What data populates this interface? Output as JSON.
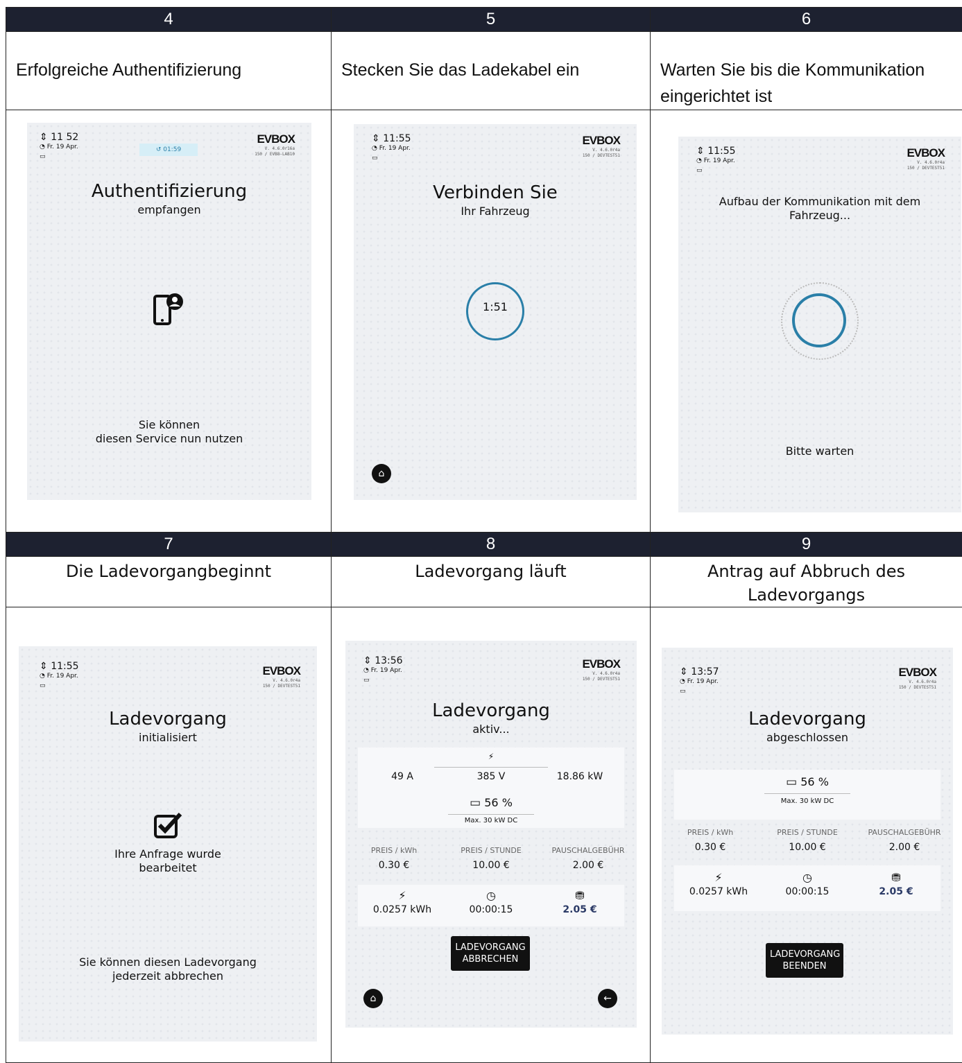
{
  "steps": [
    {
      "num": "4",
      "desc": "Erfolgreiche Authentifizierung",
      "time": "11 52",
      "date": "Fr. 19 Apr.",
      "timer": "01:59",
      "logo": "EVBOX",
      "ver1": "V. 4.6.0r16a",
      "ver2": "150 / EVB8-LAB10",
      "title": "Authentifizierung",
      "sub": "empfangen",
      "msg1": "Sie können",
      "msg2": "diesen Service nun nutzen",
      "icon": "phone-user-icon"
    },
    {
      "num": "5",
      "desc": "Stecken Sie das Ladekabel ein",
      "time": "11:55",
      "date": "Fr. 19 Apr.",
      "logo": "EVBOX",
      "ver1": "V. 4.6.0r4a",
      "ver2": "150 / DEVTEST51",
      "title": "Verbinden Sie",
      "sub": "Ihr Fahrzeug",
      "countdown": "1:51"
    },
    {
      "num": "6",
      "desc": "Warten Sie bis die Kommunikation eingerichtet ist",
      "time": "11:55",
      "date": "Fr. 19 Apr.",
      "logo": "EVBOX",
      "ver1": "V. 4.6.0r4a",
      "ver2": "150 / DEVTEST51",
      "title1": "Aufbau der Kommunikation mit dem",
      "title2": "Fahrzeug...",
      "msg": "Bitte warten"
    },
    {
      "num": "7",
      "desc": "Die Ladevorgangbeginnt",
      "time": "11:55",
      "date": "Fr. 19 Apr.",
      "logo": "EVBOX",
      "ver1": "V. 4.6.0r4a",
      "ver2": "150 / DEVTEST51",
      "title": "Ladevorgang",
      "sub": "initialisiert",
      "msgA1": "Ihre Anfrage wurde",
      "msgA2": "bearbeitet",
      "msgB1": "Sie können diesen Ladevorgang",
      "msgB2": "jederzeit abbrechen"
    },
    {
      "num": "8",
      "desc": "Ladevorgang läuft",
      "time": "13:56",
      "date": "Fr. 19 Apr.",
      "logo": "EVBOX",
      "ver1": "V. 4.6.0r4a",
      "ver2": "150 / DEVTEST51",
      "title": "Ladevorgang",
      "sub": "aktiv...",
      "amp": "49 A",
      "volt": "385 V",
      "kw": "18.86 kW",
      "soc": "56 %",
      "max": "Max. 30 kW DC",
      "l1": "PREIS / kWh",
      "l2": "PREIS / STUNDE",
      "l3": "PAUSCHALGEBÜHR",
      "p1": "0.30 €",
      "p2": "10.00 €",
      "p3": "2.00 €",
      "energy": "0.0257 kWh",
      "duration": "00:00:15",
      "cost": "2.05 €",
      "btn1": "LADEVORGANG",
      "btn2": "ABBRECHEN"
    },
    {
      "num": "9",
      "desc": "Antrag auf Abbruch des Ladevorgangs",
      "time": "13:57",
      "date": "Fr. 19 Apr.",
      "logo": "EVBOX",
      "ver1": "V. 4.6.0r4a",
      "ver2": "150 / DEVTEST51",
      "title": "Ladevorgang",
      "sub": "abgeschlossen",
      "soc": "56 %",
      "max": "Max. 30 kW DC",
      "l1": "PREIS / kWh",
      "l2": "PREIS / STUNDE",
      "l3": "PAUSCHALGEBÜHR",
      "p1": "0.30 €",
      "p2": "10.00 €",
      "p3": "2.00 €",
      "energy": "0.0257 kWh",
      "duration": "00:00:15",
      "cost": "2.05 €",
      "btn1": "LADEVORGANG",
      "btn2": "BEENDEN"
    }
  ],
  "colors": {
    "header_bg": "#1d2130",
    "ring": "#2a7fa8",
    "accent_cost": "#2b3a66"
  }
}
